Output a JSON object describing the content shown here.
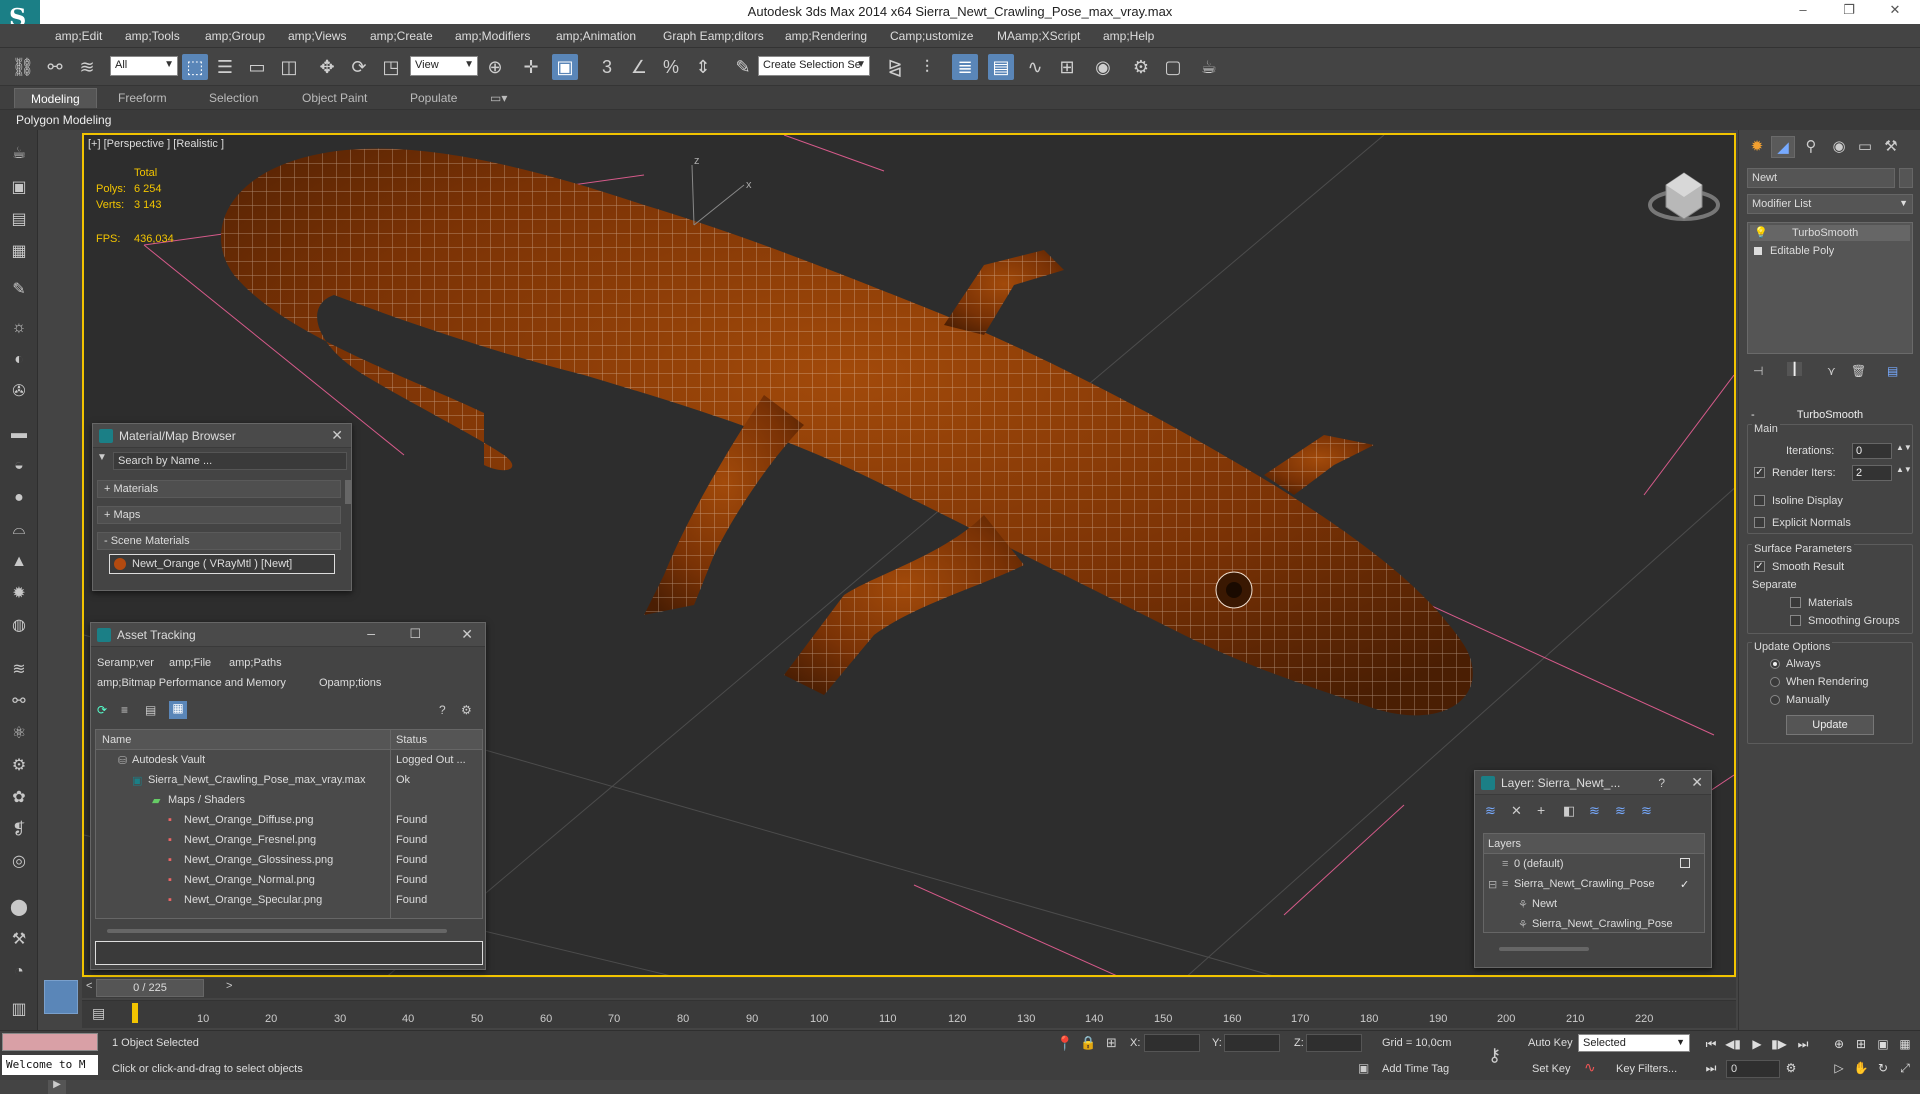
{
  "window": {
    "title": "Autodesk 3ds Max  2014 x64     Sierra_Newt_Crawling_Pose_max_vray.max",
    "minimize": "–",
    "restore": "❐",
    "close": "✕"
  },
  "menu": [
    "amp;Edit",
    "amp;Tools",
    "amp;Group",
    "amp;Views",
    "amp;Create",
    "amp;Modifiers",
    "amp;Animation",
    "Graph Eamp;ditors",
    "amp;Rendering",
    "Camp;ustomize",
    "MAamp;XScript",
    "amp;Help"
  ],
  "toolbar": {
    "selection_filter": "All",
    "ref_coord": "View",
    "named_selection": "Create Selection Se"
  },
  "ribbon": {
    "tabs": [
      "Modeling",
      "Freeform",
      "Selection",
      "Object Paint",
      "Populate"
    ],
    "active_tab": "Modeling",
    "sub_label": "Polygon Modeling"
  },
  "viewport": {
    "label": "[+] [Perspective ] [Realistic ]",
    "stats_header": "Total",
    "polys_label": "Polys:",
    "polys_value": "6 254",
    "verts_label": "Verts:",
    "verts_value": "3 143",
    "fps_label": "FPS:",
    "fps_value": "436,034",
    "axis_z": "z",
    "axis_x": "x"
  },
  "material_browser": {
    "title": "Material/Map Browser",
    "search_placeholder": "Search by Name ...",
    "groups": [
      "+ Materials",
      "+ Maps",
      "- Scene Materials"
    ],
    "scene_material": "Newt_Orange  ( VRayMtl ) [Newt]"
  },
  "asset_tracking": {
    "title": "Asset Tracking",
    "menu_row1": [
      "Seramp;ver",
      "amp;File",
      "amp;Paths"
    ],
    "menu_row2": [
      "amp;Bitmap Performance and Memory",
      "Opamp;tions"
    ],
    "col_name": "Name",
    "col_status": "Status",
    "rows": [
      {
        "name": "Autodesk Vault",
        "status": "Logged Out ..."
      },
      {
        "name": "Sierra_Newt_Crawling_Pose_max_vray.max",
        "status": "Ok"
      },
      {
        "name": "Maps / Shaders",
        "status": ""
      },
      {
        "name": "Newt_Orange_Diffuse.png",
        "status": "Found"
      },
      {
        "name": "Newt_Orange_Fresnel.png",
        "status": "Found"
      },
      {
        "name": "Newt_Orange_Glossiness.png",
        "status": "Found"
      },
      {
        "name": "Newt_Orange_Normal.png",
        "status": "Found"
      },
      {
        "name": "Newt_Orange_Specular.png",
        "status": "Found"
      }
    ]
  },
  "layer_panel": {
    "title": "Layer: Sierra_Newt_...",
    "help": "?",
    "header": "Layers",
    "items": [
      "0 (default)",
      "Sierra_Newt_Crawling_Pose",
      "Newt",
      "Sierra_Newt_Crawling_Pose"
    ]
  },
  "command_panel": {
    "object_name": "Newt",
    "modifier_list": "Modifier List",
    "stack": [
      "TurboSmooth",
      "Editable Poly"
    ],
    "rollout_title": "TurboSmooth",
    "main_group": "Main",
    "iterations_label": "Iterations:",
    "iterations_value": "0",
    "render_iters_label": "Render Iters:",
    "render_iters_value": "2",
    "isoline": "Isoline Display",
    "explicit_normals": "Explicit Normals",
    "surface_params": "Surface Parameters",
    "smooth_result": "Smooth Result",
    "separate": "Separate",
    "materials": "Materials",
    "smoothing_groups": "Smoothing Groups",
    "update_options": "Update Options",
    "always": "Always",
    "when_rendering": "When Rendering",
    "manually": "Manually",
    "update_button": "Update"
  },
  "timeline": {
    "frame_display": "0 / 225",
    "ticks": [
      "10",
      "20",
      "30",
      "40",
      "50",
      "60",
      "70",
      "80",
      "90",
      "100",
      "110",
      "120",
      "130",
      "140",
      "150",
      "160",
      "170",
      "180",
      "190",
      "200",
      "210",
      "220"
    ]
  },
  "status": {
    "maxscript": "Welcome to M",
    "selected": "1 Object Selected",
    "prompt": "Click or click-and-drag to select objects",
    "x_label": "X:",
    "y_label": "Y:",
    "z_label": "Z:",
    "grid": "Grid = 10,0cm",
    "add_time_tag": "Add Time Tag",
    "auto_key": "Auto Key",
    "set_key": "Set Key",
    "key_mode": "Selected",
    "key_filters": "Key Filters...",
    "frame_value": "0"
  },
  "colors": {
    "accent": "#f2c400",
    "active_blue": "#5a86b8",
    "brand_teal": "#1b7f86",
    "newt_body": "#8a3a06"
  }
}
